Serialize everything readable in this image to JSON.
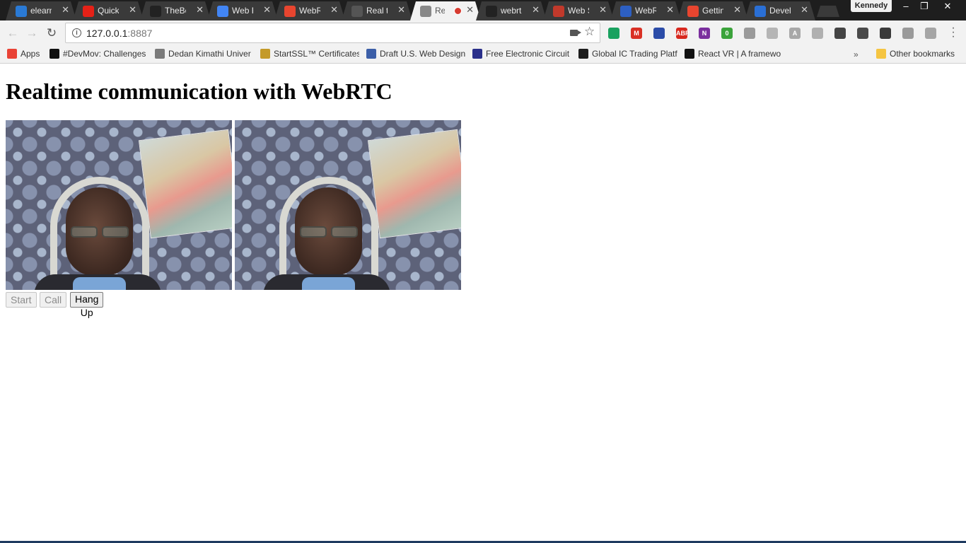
{
  "browser": {
    "tabs": [
      {
        "title": "elearn",
        "favicon": "cloud-icon",
        "color": "#2a7ad5",
        "active": false
      },
      {
        "title": "Quick",
        "favicon": "youtube-icon",
        "color": "#e62117",
        "active": false
      },
      {
        "title": "TheBe",
        "favicon": "github-icon",
        "color": "#222222",
        "active": false
      },
      {
        "title": "Web R",
        "favicon": "google-icon",
        "color": "#4285f4",
        "active": false
      },
      {
        "title": "WebRT",
        "favicon": "webrtc-icon",
        "color": "#e8452f",
        "active": false
      },
      {
        "title": "Real ti",
        "favicon": "compass-icon",
        "color": "#555555",
        "active": false
      },
      {
        "title": "Rea",
        "favicon": "page-icon",
        "color": "#888888",
        "active": true
      },
      {
        "title": "webrtc",
        "favicon": "github-icon",
        "color": "#222222",
        "active": false
      },
      {
        "title": "Web S",
        "favicon": "mdn-icon",
        "color": "#c1392b",
        "active": false
      },
      {
        "title": "WebR",
        "favicon": "html5-icon",
        "color": "#2d5fc2",
        "active": false
      },
      {
        "title": "Gettin",
        "favicon": "webrtc-icon",
        "color": "#e8452f",
        "active": false
      },
      {
        "title": "Devel",
        "favicon": "docs-icon",
        "color": "#2a6fd5",
        "active": false
      }
    ],
    "profile_name": "Kennedy",
    "window_controls": {
      "minimize": "–",
      "restore": "❐",
      "close": "✕"
    }
  },
  "toolbar": {
    "url_host": "127.0.0.1",
    "url_port": ":8887",
    "extensions": [
      {
        "name": "evernote-icon",
        "color": "#19a15f",
        "label": ""
      },
      {
        "name": "gmail-icon",
        "color": "#d93025",
        "label": "M"
      },
      {
        "name": "eagle-icon",
        "color": "#2b4ca8",
        "label": ""
      },
      {
        "name": "adblock-plus-icon",
        "color": "#d8281e",
        "label": "ABP"
      },
      {
        "name": "onenote-icon",
        "color": "#7b2f9e",
        "label": "N"
      },
      {
        "name": "sync-icon",
        "color": "#3ba33b",
        "label": "0"
      },
      {
        "name": "monitor-icon",
        "color": "#9a9a9a",
        "label": ""
      },
      {
        "name": "android-icon",
        "color": "#b5b5b5",
        "label": ""
      },
      {
        "name": "angular-icon",
        "color": "#a8a8a8",
        "label": "A"
      },
      {
        "name": "ext-gray-icon",
        "color": "#b0b0b0",
        "label": ""
      },
      {
        "name": "bus-icon",
        "color": "#444444",
        "label": ""
      },
      {
        "name": "evernote-web-icon",
        "color": "#4a4a4a",
        "label": ""
      },
      {
        "name": "bulb-icon",
        "color": "#3a3a3a",
        "label": ""
      },
      {
        "name": "share-icon",
        "color": "#9a9a9a",
        "label": ""
      },
      {
        "name": "cloud-ext-icon",
        "color": "#a5a5a5",
        "label": ""
      }
    ]
  },
  "bookmarks": [
    {
      "label": "Apps",
      "icon": "apps-grid-icon",
      "color": "#e94235"
    },
    {
      "label": "#DevMov: Challenges",
      "icon": "m-icon",
      "color": "#111111"
    },
    {
      "label": "Dedan Kimathi Univer",
      "icon": "person-icon",
      "color": "#7a7a7a"
    },
    {
      "label": "StartSSL™ Certificates",
      "icon": "lock-badge-icon",
      "color": "#c49a29"
    },
    {
      "label": "Draft U.S. Web Design",
      "icon": "us-flag-icon",
      "color": "#3c5fa8"
    },
    {
      "label": "Free Electronic Circuit",
      "icon": "circuit-icon",
      "color": "#2a2f8a"
    },
    {
      "label": "Global IC Trading Platf",
      "icon": "ic-icon",
      "color": "#1d1d1d"
    },
    {
      "label": "React VR | A framewo",
      "icon": "react-icon",
      "color": "#111111"
    }
  ],
  "bookmarks_overflow": "»",
  "other_bookmarks": "Other bookmarks",
  "page": {
    "heading": "Realtime communication with WebRTC",
    "buttons": {
      "start": "Start",
      "call": "Call",
      "hangup": "Hang Up"
    }
  }
}
